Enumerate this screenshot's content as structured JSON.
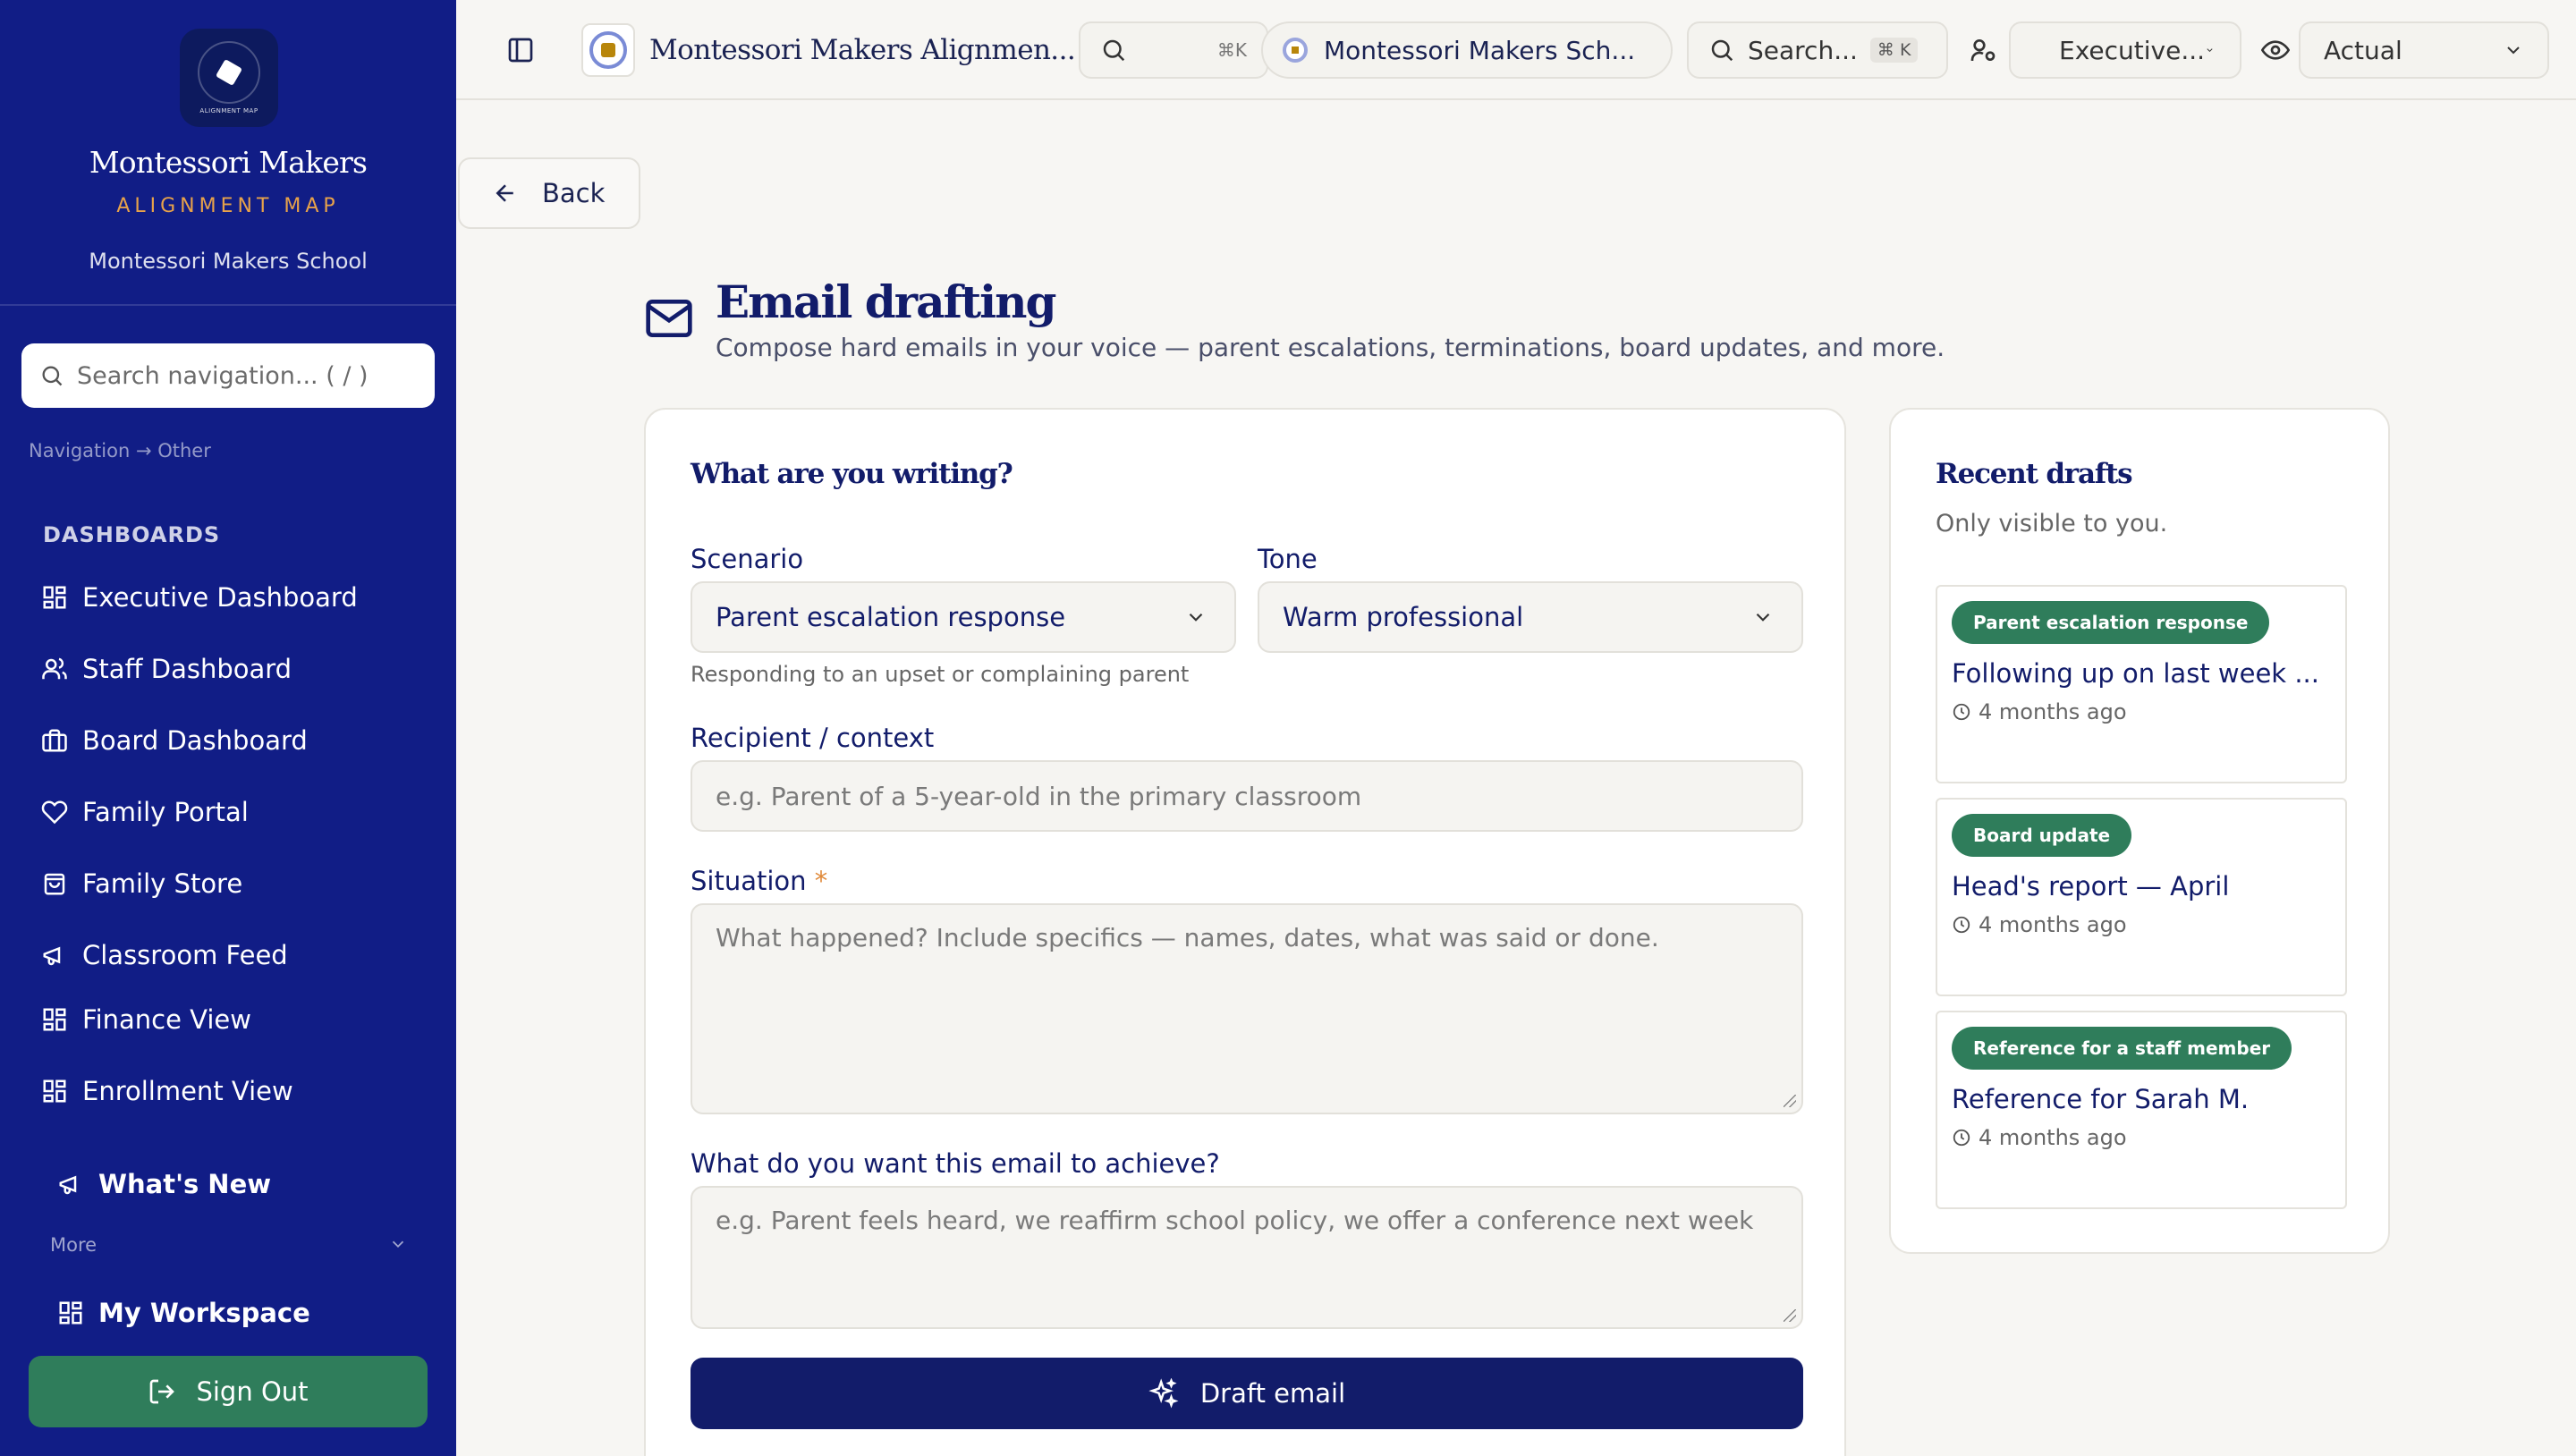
{
  "sidebar": {
    "brand_name": "Montessori Makers",
    "brand_subtitle": "ALIGNMENT MAP",
    "logo_text": "ALIGNMENT MAP",
    "school": "Montessori Makers School",
    "search_placeholder": "Search navigation... ( / )",
    "breadcrumb": "Navigation → Other",
    "section_heading": "DASHBOARDS",
    "items": [
      {
        "label": "Executive Dashboard",
        "icon": "grid-icon"
      },
      {
        "label": "Staff Dashboard",
        "icon": "users-icon"
      },
      {
        "label": "Board Dashboard",
        "icon": "briefcase-icon"
      },
      {
        "label": "Family Portal",
        "icon": "heart-icon"
      },
      {
        "label": "Family Store",
        "icon": "shopping-bag-icon"
      },
      {
        "label": "Classroom Feed",
        "icon": "megaphone-icon"
      },
      {
        "label": "Finance View",
        "icon": "grid-icon"
      },
      {
        "label": "Enrollment View",
        "icon": "grid-icon"
      }
    ],
    "whats_new": "What's New",
    "more_label": "More",
    "workspace": "My Workspace",
    "sign_out": "Sign Out",
    "colors": {
      "background": "#111d86",
      "accent": "#e7a24a",
      "sign_out": "#2f7d5b"
    }
  },
  "topbar": {
    "app_title": "Montessori Makers Alignmen...",
    "search_shortcut": "⌘K",
    "school_selector": "Montessori Makers Sch...",
    "global_search_placeholder": "Search...",
    "global_search_kbd": "⌘ K",
    "role_selector": "Executive...",
    "view_selector": "Actual"
  },
  "main": {
    "back_label": "Back",
    "title": "Email drafting",
    "subtitle": "Compose hard emails in your voice — parent escalations, terminations, board updates, and more."
  },
  "form": {
    "heading": "What are you writing?",
    "scenario_label": "Scenario",
    "scenario_value": "Parent escalation response",
    "scenario_hint": "Responding to an upset or complaining parent",
    "tone_label": "Tone",
    "tone_value": "Warm professional",
    "recipient_label": "Recipient / context",
    "recipient_placeholder": "e.g. Parent of a 5-year-old in the primary classroom",
    "situation_label": "Situation",
    "situation_required": "*",
    "situation_placeholder": "What happened? Include specifics — names, dates, what was said or done.",
    "goal_label": "What do you want this email to achieve?",
    "goal_placeholder": "e.g. Parent feels heard, we reaffirm school policy, we offer a conference next week",
    "submit_label": "Draft email"
  },
  "recent": {
    "heading": "Recent drafts",
    "subtitle": "Only visible to you.",
    "drafts": [
      {
        "badge": "Parent escalation response",
        "title": "Following up on last week ...",
        "time": "4 months ago"
      },
      {
        "badge": "Board update",
        "title": "Head's report — April",
        "time": "4 months ago"
      },
      {
        "badge": "Reference for a staff member",
        "title": "Reference for Sarah M.",
        "time": "4 months ago"
      }
    ]
  }
}
